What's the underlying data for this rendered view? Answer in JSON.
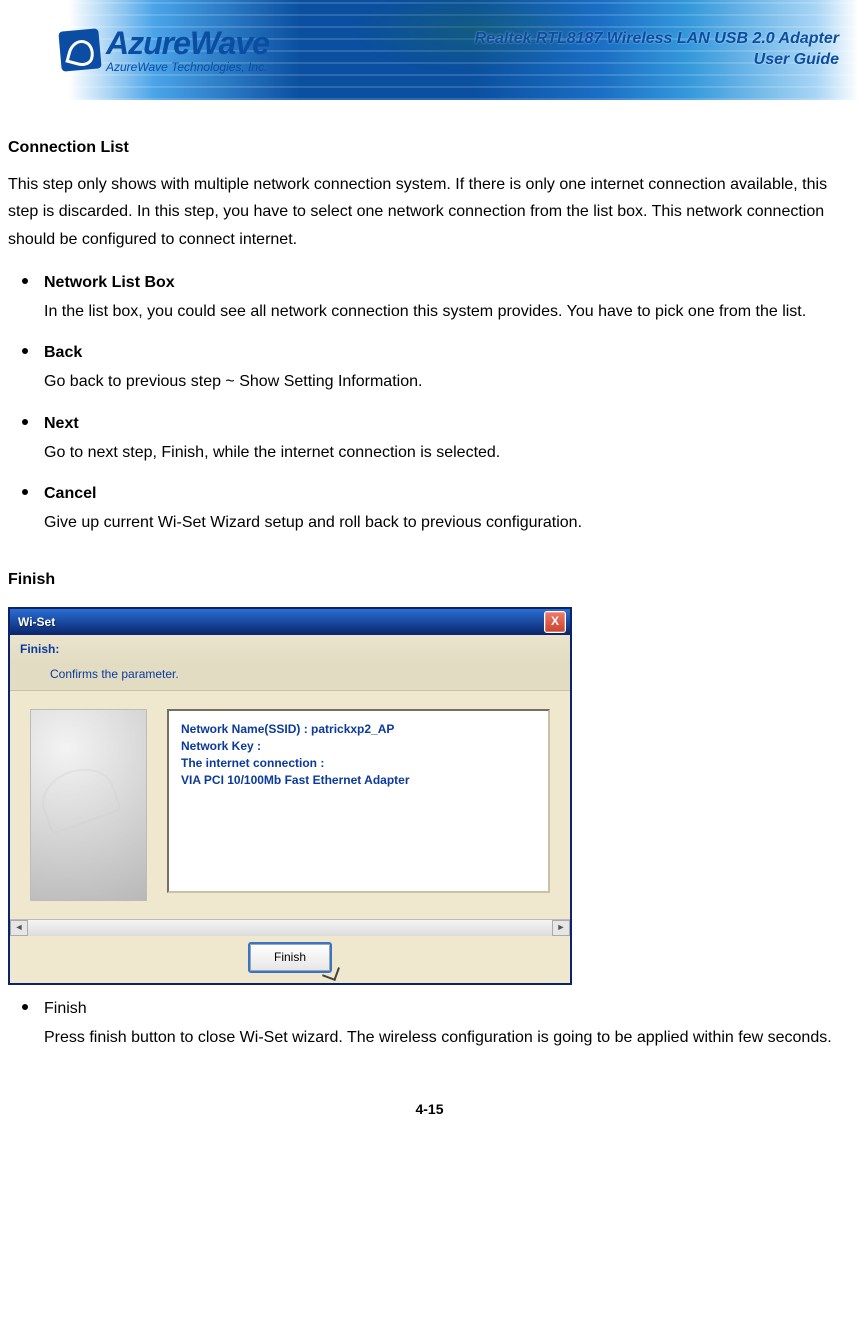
{
  "header": {
    "logo_main": "AzureWave",
    "logo_sub": "AzureWave  Technologies,  Inc.",
    "title_line1": "Realtek RTL8187 Wireless LAN USB 2.0 Adapter",
    "title_line2": "User Guide"
  },
  "sections": {
    "connection_list": {
      "heading": "Connection List",
      "intro": "This step only shows with multiple network connection system. If there is only one internet connection available, this step is discarded. In this step, you have to select one network connection from the list box. This network connection should be configured to connect internet.",
      "items": [
        {
          "title": "Network List Box",
          "desc": "In the list box, you could see all network connection this system provides. You have to pick one from the list."
        },
        {
          "title": "Back",
          "desc": "Go back to previous step ~ Show Setting Information."
        },
        {
          "title": "Next",
          "desc": "Go to next step, Finish, while the internet connection is selected."
        },
        {
          "title": "Cancel",
          "desc": "Give up current Wi-Set Wizard setup and roll back to previous configuration."
        }
      ]
    },
    "finish": {
      "heading": "Finish",
      "items": [
        {
          "title": "Finish",
          "desc": "Press finish button to close Wi-Set wizard. The wireless configuration is going to be applied within few seconds."
        }
      ]
    }
  },
  "dialog": {
    "titlebar": "Wi-Set",
    "close_glyph": "X",
    "step_title": "Finish:",
    "step_sub": "Confirms the parameter.",
    "info_lines": [
      "Network Name(SSID) : patrickxp2_AP",
      "Network Key :",
      "The internet connection :",
      "VIA PCI 10/100Mb Fast Ethernet Adapter"
    ],
    "button_label": "Finish",
    "scroll_left": "◄",
    "scroll_right": "►"
  },
  "page_number": "4-15"
}
